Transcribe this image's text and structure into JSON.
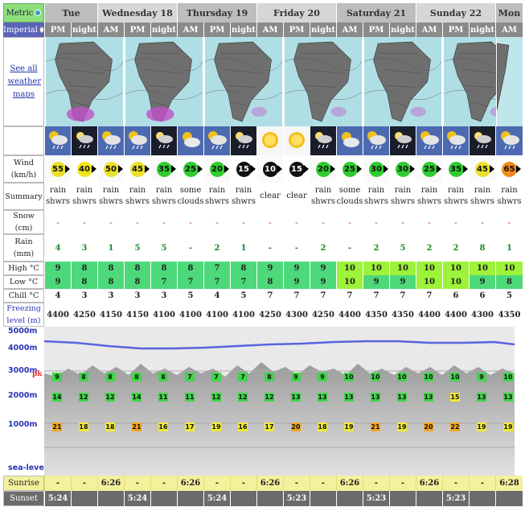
{
  "units": {
    "metric": "Metric",
    "imperial": "Imperial"
  },
  "days": [
    {
      "name": "Tue",
      "span": 2
    },
    {
      "name": "Wednesday 18",
      "span": 3
    },
    {
      "name": "Thursday 19",
      "span": 3
    },
    {
      "name": "Friday 20",
      "span": 3
    },
    {
      "name": "Saturday 21",
      "span": 3
    },
    {
      "name": "Sunday 22",
      "span": 3
    },
    {
      "name": "Mon",
      "span": 1
    }
  ],
  "phases": [
    "PM",
    "night",
    "AM",
    "PM",
    "night",
    "AM",
    "PM",
    "night",
    "AM",
    "PM",
    "night",
    "AM",
    "PM",
    "night",
    "AM",
    "PM",
    "night",
    "AM"
  ],
  "maps_link": "See all weather maps",
  "row_labels": {
    "wind": "Wind (km/h)",
    "summary": "Summary",
    "snow": "Snow (cm)",
    "rain": "Rain (mm)",
    "high": "High °C",
    "low": "Low °C",
    "chill": "Chill °C",
    "freezing": "Freezing level (m)",
    "sunrise": "Sunrise",
    "sunset": "Sunset"
  },
  "icons": [
    "cloud-rain-sun-icon",
    "night-rain-icon",
    "cloud-rain-sun-icon",
    "cloud-rain-sun-icon",
    "night-rain-icon",
    "sun-cloud-icon",
    "cloud-rain-sun-icon",
    "night-rain-icon",
    "sun-icon",
    "sun-icon",
    "night-rain-icon",
    "sun-cloud-icon",
    "cloud-rain-sun-icon",
    "night-rain-icon",
    "cloud-rain-sun-icon",
    "cloud-rain-sun-icon",
    "night-rain-icon",
    "cloud-rain-sun-icon"
  ],
  "wind": [
    {
      "v": "55",
      "c": "#e8e02a"
    },
    {
      "v": "40",
      "c": "#f0e51c"
    },
    {
      "v": "50",
      "c": "#e8e02a"
    },
    {
      "v": "45",
      "c": "#e8e02a"
    },
    {
      "v": "35",
      "c": "#2fcc2f"
    },
    {
      "v": "25",
      "c": "#2fcc2f"
    },
    {
      "v": "20",
      "c": "#2fcc2f"
    },
    {
      "v": "15",
      "c": "#111111"
    },
    {
      "v": "10",
      "c": "#111111"
    },
    {
      "v": "15",
      "c": "#111111"
    },
    {
      "v": "20",
      "c": "#2fcc2f"
    },
    {
      "v": "25",
      "c": "#2fcc2f"
    },
    {
      "v": "30",
      "c": "#2fcc2f"
    },
    {
      "v": "30",
      "c": "#2fcc2f"
    },
    {
      "v": "25",
      "c": "#2fcc2f"
    },
    {
      "v": "35",
      "c": "#2fcc2f"
    },
    {
      "v": "45",
      "c": "#e8e02a"
    },
    {
      "v": "65",
      "c": "#f08a1a"
    }
  ],
  "summary": [
    "rain shwrs",
    "rain shwrs",
    "rain shwrs",
    "rain shwrs",
    "rain shwrs",
    "some clouds",
    "rain shwrs",
    "rain shwrs",
    "clear",
    "clear",
    "rain shwrs",
    "some clouds",
    "rain shwrs",
    "rain shwrs",
    "rain shwrs",
    "rain shwrs",
    "rain shwrs",
    "rain shwrs"
  ],
  "snow": [
    "-",
    "-",
    "-",
    "-",
    "-",
    "-",
    "-",
    "-",
    "-",
    "-",
    "-",
    "-",
    "-",
    "-",
    "-",
    "-",
    "-",
    "-"
  ],
  "rain": [
    "4",
    "3",
    "1",
    "5",
    "5",
    "-",
    "2",
    "1",
    "-",
    "-",
    "2",
    "-",
    "2",
    "5",
    "2",
    "2",
    "8",
    "1"
  ],
  "high": [
    "9",
    "8",
    "8",
    "8",
    "8",
    "8",
    "7",
    "8",
    "9",
    "9",
    "9",
    "10",
    "10",
    "10",
    "10",
    "10",
    "10",
    "10"
  ],
  "low": [
    "9",
    "8",
    "8",
    "8",
    "7",
    "7",
    "7",
    "7",
    "8",
    "9",
    "9",
    "10",
    "9",
    "9",
    "10",
    "10",
    "9",
    "8"
  ],
  "chill": [
    "4",
    "3",
    "3",
    "3",
    "3",
    "5",
    "4",
    "5",
    "7",
    "7",
    "7",
    "7",
    "7",
    "7",
    "7",
    "6",
    "6",
    "5"
  ],
  "freezing": [
    "4400",
    "4250",
    "4150",
    "4150",
    "4100",
    "4100",
    "4100",
    "4100",
    "4250",
    "4300",
    "4250",
    "4400",
    "4350",
    "4350",
    "4400",
    "4400",
    "4300",
    "4350"
  ],
  "sunrise": [
    "-",
    "-",
    "6:26",
    "-",
    "-",
    "6:26",
    "-",
    "-",
    "6:26",
    "-",
    "-",
    "6:26",
    "-",
    "-",
    "6:26",
    "-",
    "-",
    "6:28"
  ],
  "sunset": [
    "5:24",
    "",
    "",
    "5:24",
    "",
    "",
    "5:24",
    "",
    "",
    "5:23",
    "",
    "",
    "5:23",
    "",
    "",
    "5:23",
    "",
    ""
  ],
  "altitudes": {
    "a5000": "5000m",
    "a4000": "4000m",
    "a3000": "3000m",
    "a2000": "2000m",
    "a1000": "1000m",
    "sea": "sea-level",
    "pk": "pk"
  },
  "levels_peak": [
    "9",
    "8",
    "8",
    "8",
    "8",
    "7",
    "7",
    "7",
    "8",
    "9",
    "9",
    "10",
    "10",
    "10",
    "10",
    "10",
    "9",
    "10"
  ],
  "levels_mid": [
    "14",
    "12",
    "12",
    "14",
    "11",
    "11",
    "12",
    "12",
    "12",
    "13",
    "13",
    "13",
    "13",
    "13",
    "13",
    "15",
    "13",
    "13"
  ],
  "levels_low": [
    "21",
    "18",
    "18",
    "21",
    "16",
    "17",
    "19",
    "16",
    "17",
    "20",
    "18",
    "19",
    "21",
    "19",
    "20",
    "22",
    "19",
    "19"
  ],
  "colors": {
    "metric_bg": "#8ee07a",
    "imperial_bg": "#5b63b8",
    "high_green": "#4dd97a",
    "bright_green": "#9df23a",
    "sunrise_bg": "#f3f19c",
    "sunset_bg": "#6b6b6b",
    "freezing_line": "#5a63e0"
  }
}
